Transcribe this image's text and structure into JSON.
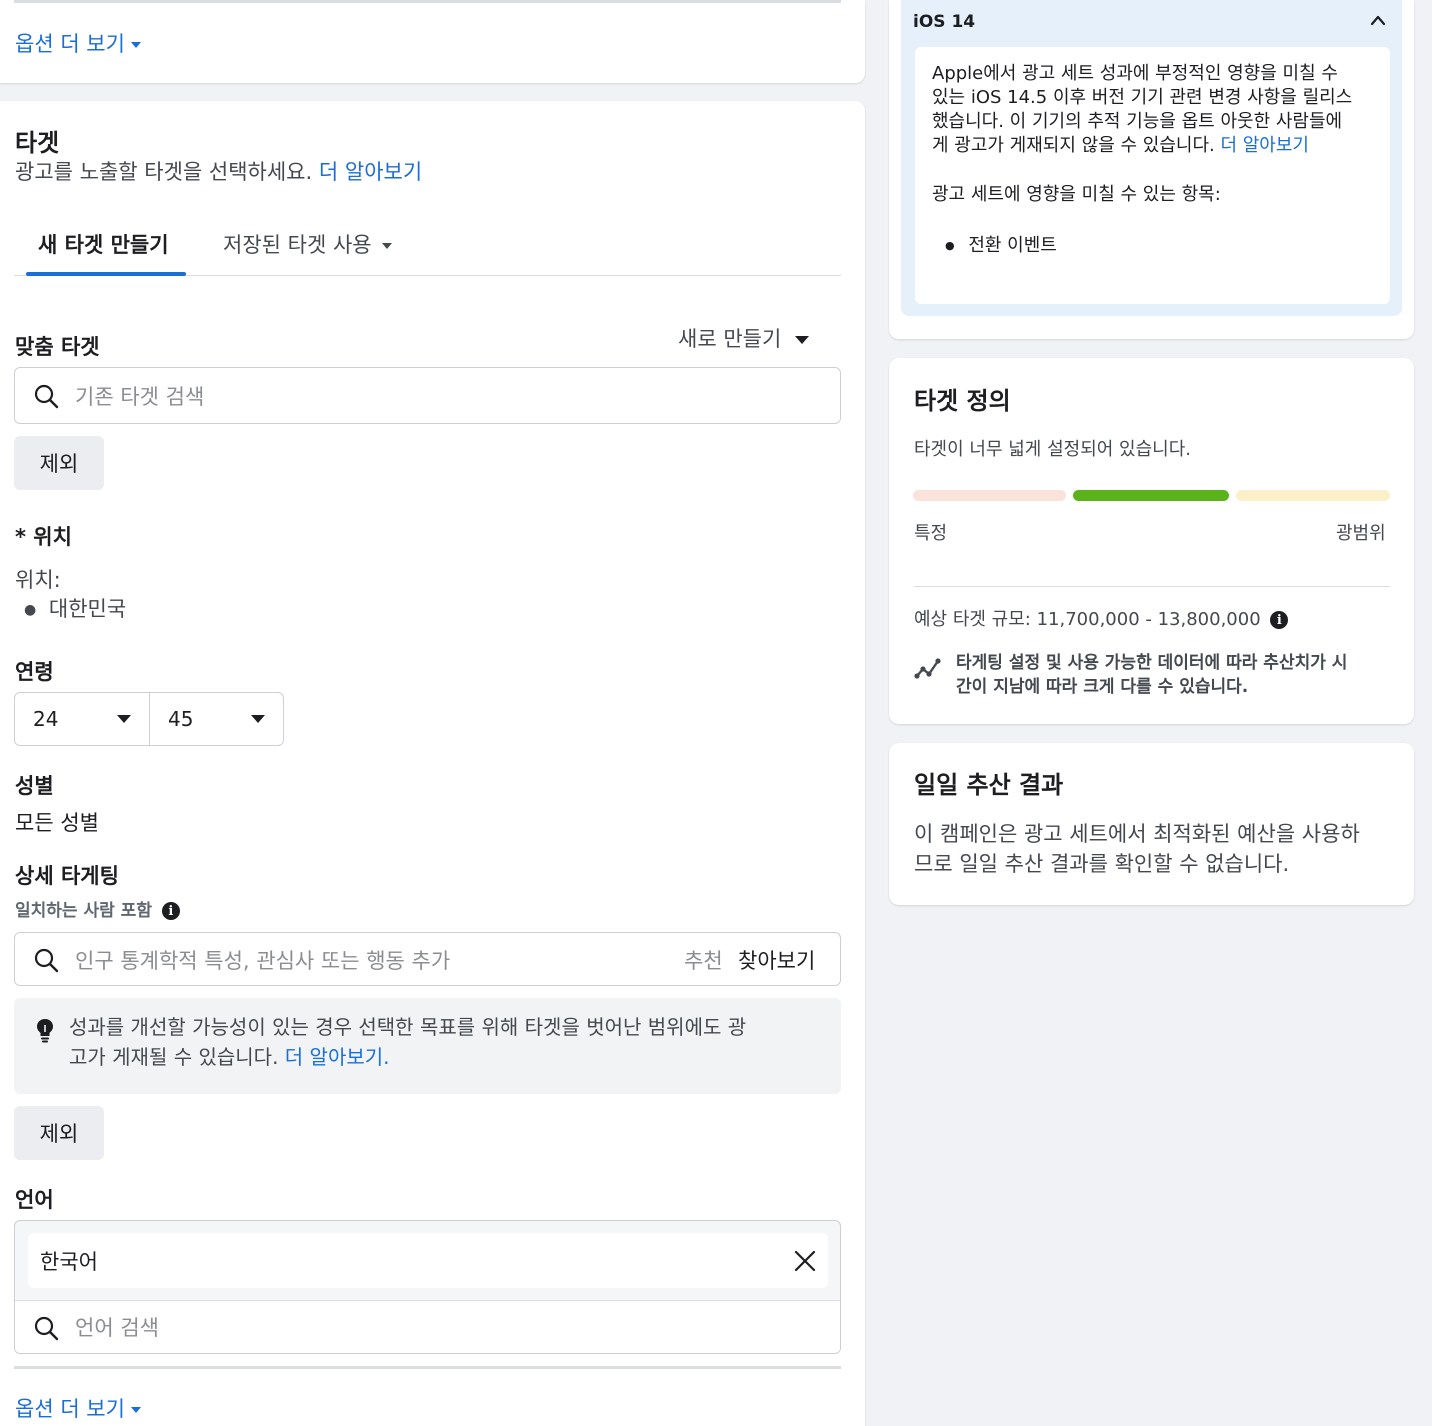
{
  "top_card": {
    "more_options": "옵션 더 보기"
  },
  "audience": {
    "title": "타겟",
    "subtitle": "광고를 노출할 타겟을 선택하세요.",
    "learn_more": "더 알아보기",
    "tabs": {
      "new": "새 타겟 만들기",
      "saved": "저장된 타겟 사용"
    },
    "custom": {
      "label": "맞춤 타겟",
      "create_new": "새로 만들기",
      "search_placeholder": "기존 타겟 검색",
      "exclude": "제외"
    },
    "location": {
      "label": "* 위치",
      "sub": "위치:",
      "items": [
        "대한민국"
      ]
    },
    "age": {
      "label": "연령",
      "min": "24",
      "max": "45"
    },
    "gender": {
      "label": "성별",
      "value": "모든 성별"
    },
    "detailed": {
      "label": "상세 타게팅",
      "sub": "일치하는 사람 포함",
      "search_placeholder": "인구 통계학적 특성, 관심사 또는 행동 추가",
      "suggest": "추천",
      "browse": "찾아보기",
      "tip_line1": "성과를 개선할 가능성이 있는 경우 선택한 목표를 위해 타겟을 벗어난 범위에도 광",
      "tip_line2": "고가 게재될 수 있습니다.",
      "tip_link": "더 알아보기.",
      "exclude": "제외"
    },
    "language": {
      "label": "언어",
      "selected": "한국어",
      "search_placeholder": "언어 검색"
    },
    "more_options": "옵션 더 보기"
  },
  "ios": {
    "title": "iOS 14",
    "line1": "Apple에서 광고 세트 성과에 부정적인 영향을 미칠 수",
    "line2": "있는 iOS 14.5 이후 버전 기기 관련 변경 사항을 릴리스",
    "line3": "했습니다. 이 기기의 추적 기능을 옵트 아웃한 사람들에",
    "line4": "게 광고가 게재되지 않을 수 있습니다.",
    "learn_more": "더 알아보기",
    "affects": "광고 세트에 영향을 미칠 수 있는 항목:",
    "items": [
      "전환 이벤트"
    ]
  },
  "definition": {
    "title": "타겟 정의",
    "status": "타겟이 너무 넓게 설정되어 있습니다.",
    "meter_level": 0.5,
    "specific": "특정",
    "broad": "광범위",
    "estimate": "예상 타겟 규모: 11,700,000 - 13,800,000",
    "note1": "타게팅 설정 및 사용 가능한 데이터에 따라 추산치가 시",
    "note2": "간이 지남에 따라 크게 다를 수 있습니다.",
    "colors": {
      "specific": "#fbe3dc",
      "active": "#5ab31a",
      "broad": "#fcf0c9"
    }
  },
  "daily": {
    "title": "일일 추산 결과",
    "line1": "이 캠페인은 광고 세트에서 최적화된 예산을 사용하",
    "line2": "므로 일일 추산 결과를 확인할 수 없습니다."
  }
}
